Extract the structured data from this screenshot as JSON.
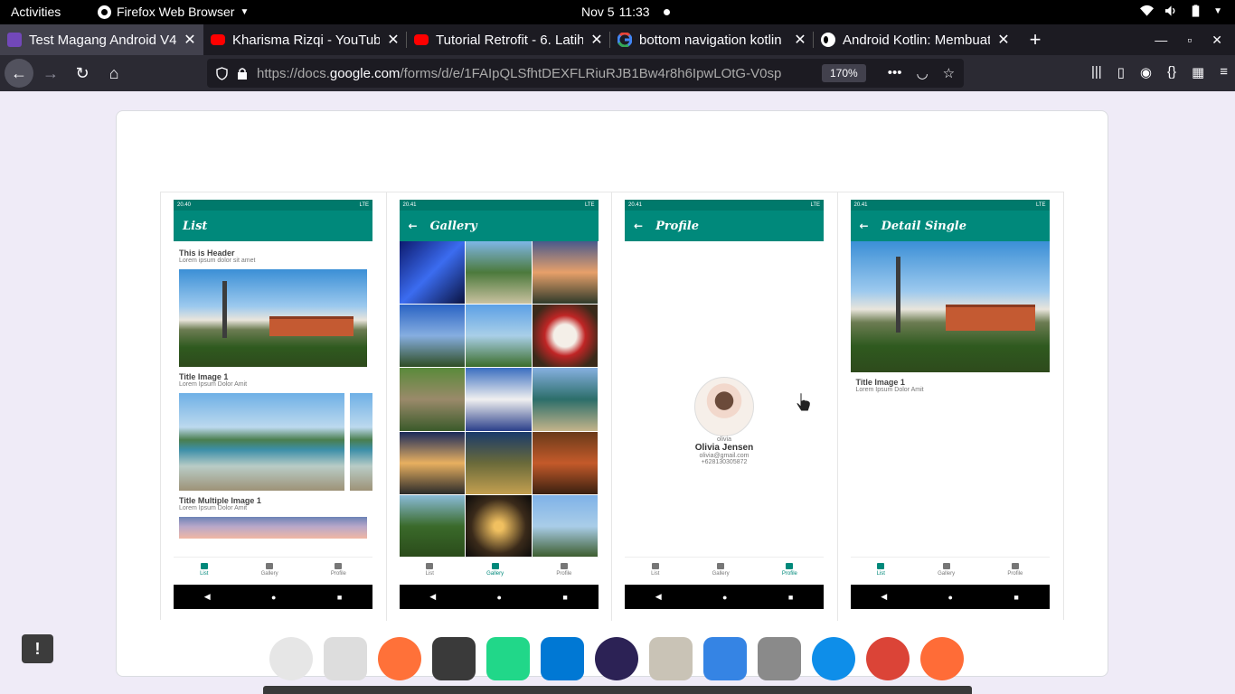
{
  "topbar": {
    "activities": "Activities",
    "app_menu": "Firefox Web Browser",
    "date": "Nov 5",
    "time": "11:33"
  },
  "tabs": [
    {
      "title": "Test Magang Android V4",
      "icon": "forms-icon",
      "active": true
    },
    {
      "title": "Kharisma Rizqi - YouTube",
      "icon": "youtube-icon"
    },
    {
      "title": "Tutorial Retrofit - 6. Latih",
      "icon": "youtube-icon"
    },
    {
      "title": "bottom navigation kotlin",
      "icon": "google-icon"
    },
    {
      "title": "Android Kotlin: Membuat",
      "icon": "medium-icon"
    }
  ],
  "urlbar": {
    "url_prefix": "https://docs.",
    "url_domain": "google.com",
    "url_rest": "/forms/d/e/1FAIpQLSfhtDEXFLRiuRJB1Bw4r8h6IpwLOtG-V0sp",
    "zoom": "170%"
  },
  "screens": {
    "list": {
      "status": "20.40",
      "status_right": "LTE",
      "title": "List",
      "header_title": "This is Header",
      "header_sub": "Lorem ipsum dolor sit amet",
      "item1_title": "Title Image 1",
      "item1_sub": "Lorem Ipsum Dolor Amit",
      "item2_title": "Title Multiple Image 1",
      "item2_sub": "Lorem Ipsum Dolor Amit"
    },
    "gallery": {
      "status": "20.41",
      "status_right": "LTE",
      "title": "Gallery"
    },
    "profile": {
      "status": "20.41",
      "status_right": "LTE",
      "title": "Profile",
      "username": "olivia",
      "name": "Olivia Jensen",
      "email": "olivia@gmail.com",
      "phone": "+628130305872"
    },
    "detail": {
      "status": "20.41",
      "status_right": "LTE",
      "title": "Detail Single",
      "item_title": "Title Image 1",
      "item_sub": "Lorem Ipsum Dolor Amit"
    }
  },
  "bottom_nav": {
    "list": "List",
    "gallery": "Gallery",
    "profile": "Profile"
  },
  "feedback_label": "!",
  "dock": [
    {
      "name": "android-studio-icon",
      "color": "#e6e6e6"
    },
    {
      "name": "text-editor-icon",
      "color": "#dddddd"
    },
    {
      "name": "firefox-icon",
      "color": "#ff7139"
    },
    {
      "name": "terminal-icon",
      "color": "#3a3a3a"
    },
    {
      "name": "intellij-icon",
      "color": "#21d789"
    },
    {
      "name": "vscode-icon",
      "color": "#0078d4"
    },
    {
      "name": "eclipse-icon",
      "color": "#2c2255"
    },
    {
      "name": "files-icon",
      "color": "#c9c3b6"
    },
    {
      "name": "screenshot-icon",
      "color": "#3584e4"
    },
    {
      "name": "database-icon",
      "color": "#8a8a8a"
    },
    {
      "name": "teamviewer-icon",
      "color": "#0e8ee9"
    },
    {
      "name": "chrome-icon",
      "color": "#db4437"
    },
    {
      "name": "postman-icon",
      "color": "#ff6c37"
    }
  ]
}
